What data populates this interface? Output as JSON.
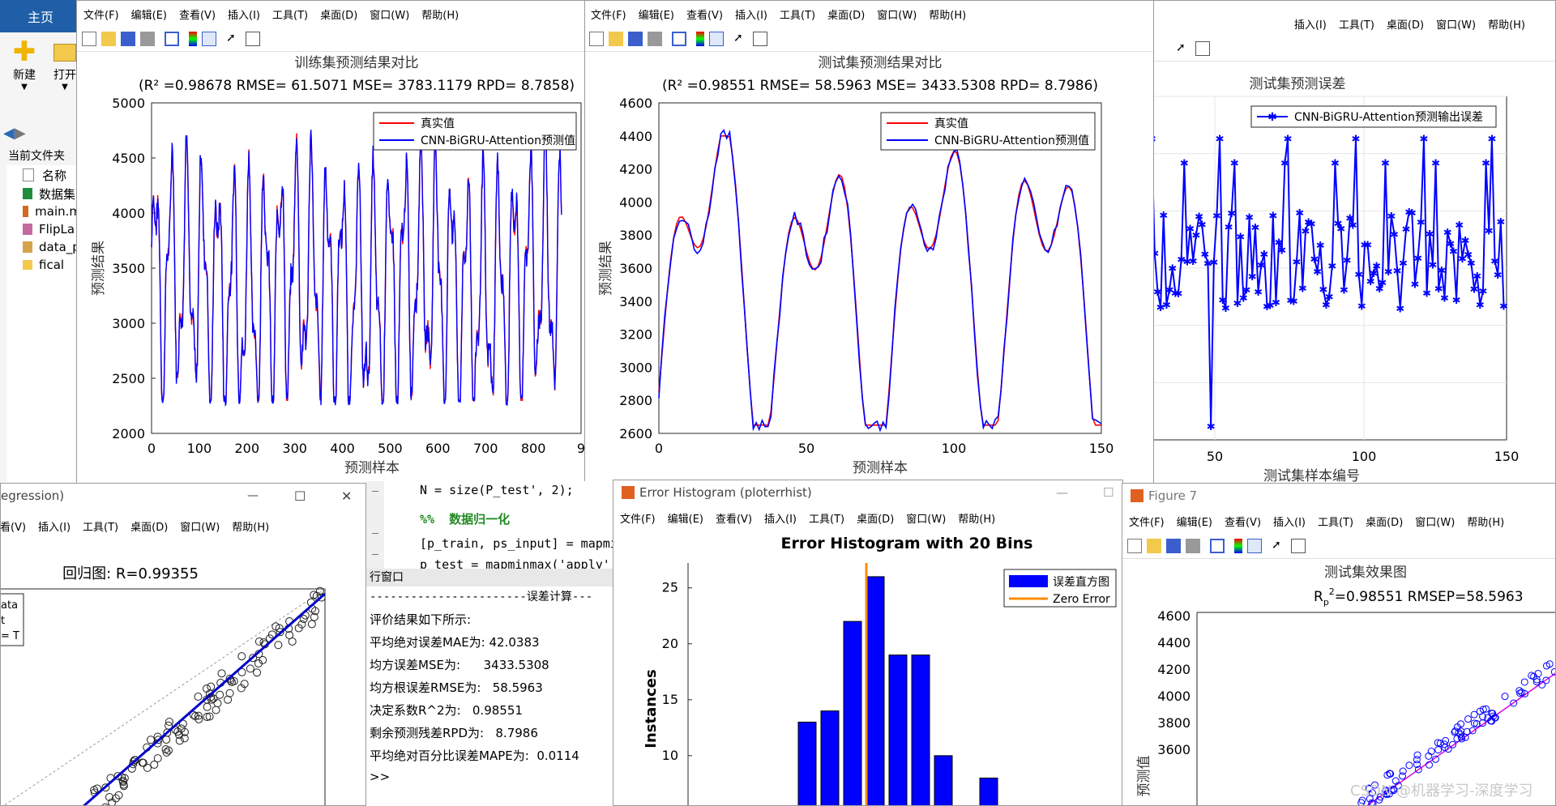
{
  "menu": {
    "file": "文件(F)",
    "edit": "编辑(E)",
    "view": "查看(V)",
    "insert": "插入(I)",
    "tools": "工具(T)",
    "desktop": "桌面(D)",
    "window": "窗口(W)",
    "help": "帮助(H)"
  },
  "matlab": {
    "home_tab": "主页",
    "new_label": "新建",
    "open_label": "打开",
    "current_folder": "当前文件夹",
    "name_col": "名称",
    "files": [
      "数据集",
      "main.m",
      "FlipLa",
      "data_p",
      "fical"
    ]
  },
  "fig_train": {
    "title": "训练集预测结果对比",
    "subtitle": "(R² =0.98678 RMSE= 61.5071 MSE= 3783.1179 RPD= 8.7858)",
    "legend_true": "真实值",
    "legend_pred": "CNN-BiGRU-Attention预测值",
    "xlabel": "预测样本",
    "ylabel": "预测结果",
    "xticks": [
      "0",
      "100",
      "200",
      "300",
      "400",
      "500",
      "600",
      "700",
      "800",
      "9"
    ],
    "yticks": [
      "2000",
      "2500",
      "3000",
      "3500",
      "4000",
      "4500",
      "5000"
    ]
  },
  "fig_test": {
    "title": "测试集预测结果对比",
    "subtitle": "(R² =0.98551 RMSE= 58.5963 MSE= 3433.5308 RPD= 8.7986)",
    "legend_true": "真实值",
    "legend_pred": "CNN-BiGRU-Attention预测值",
    "xlabel": "预测样本",
    "ylabel": "预测结果",
    "xticks": [
      "0",
      "50",
      "100",
      "150"
    ],
    "yticks": [
      "2600",
      "2800",
      "3000",
      "3200",
      "3400",
      "3600",
      "3800",
      "4000",
      "4200",
      "4400",
      "4600"
    ]
  },
  "fig_err": {
    "title": "测试集预测误差",
    "legend": "CNN-BiGRU-Attention预测输出误差",
    "xlabel": "测试集样本编号",
    "xticks": [
      "50",
      "100",
      "150"
    ]
  },
  "fig_reg": {
    "title_partial": "egression)",
    "plot_title": "回归图: R=0.99355",
    "legend_lines": [
      "ata",
      "t",
      "= T"
    ],
    "win_min": "—",
    "win_max": "☐",
    "win_close": "✕"
  },
  "editor": {
    "line1": "N = size(P_test', 2);",
    "line2": "%%  数据归一化",
    "line3": "[p_train, ps_input] = mapmi",
    "line4": "p_test = mapminmax('apply',"
  },
  "cmd": {
    "header": "行窗口",
    "divider": "-----------------------误差计算---",
    "intro": "评价结果如下所示:",
    "mae": "平均绝对误差MAE为: 42.0383",
    "mse": "均方误差MSE为:      3433.5308",
    "rmse": "均方根误差RMSE为:   58.5963",
    "r2": "决定系数R^2为:   0.98551",
    "rpd": "剩余预测残差RPD为:   8.7986",
    "mape": "平均绝对百分比误差MAPE为:  0.0114",
    "prompt": ">>"
  },
  "fig_hist": {
    "window_title": "Error Histogram (ploterrhist)",
    "title": "Error Histogram with 20 Bins",
    "ylabel": "Instances",
    "legend_hist": "误差直方图",
    "legend_zero": "Zero Error",
    "yticks": [
      "10",
      "15",
      "20",
      "25"
    ],
    "bars": [
      13,
      14,
      22,
      26,
      19,
      19,
      10,
      0,
      8
    ]
  },
  "fig7": {
    "window_title": "Figure 7",
    "title": "测试集效果图",
    "subtitle_main": "R",
    "subtitle_rest": "=0.98551  RMSEP=58.5963",
    "ylabel": "预测值",
    "yticks": [
      "3600",
      "3800",
      "4000",
      "4200",
      "4400",
      "4600"
    ]
  },
  "watermark": "CSDN @机器学习-深度学习",
  "colors": {
    "true": "#ff0000",
    "pred": "#0000ff",
    "zero": "#ff8c00",
    "magenta": "#e000e0"
  }
}
